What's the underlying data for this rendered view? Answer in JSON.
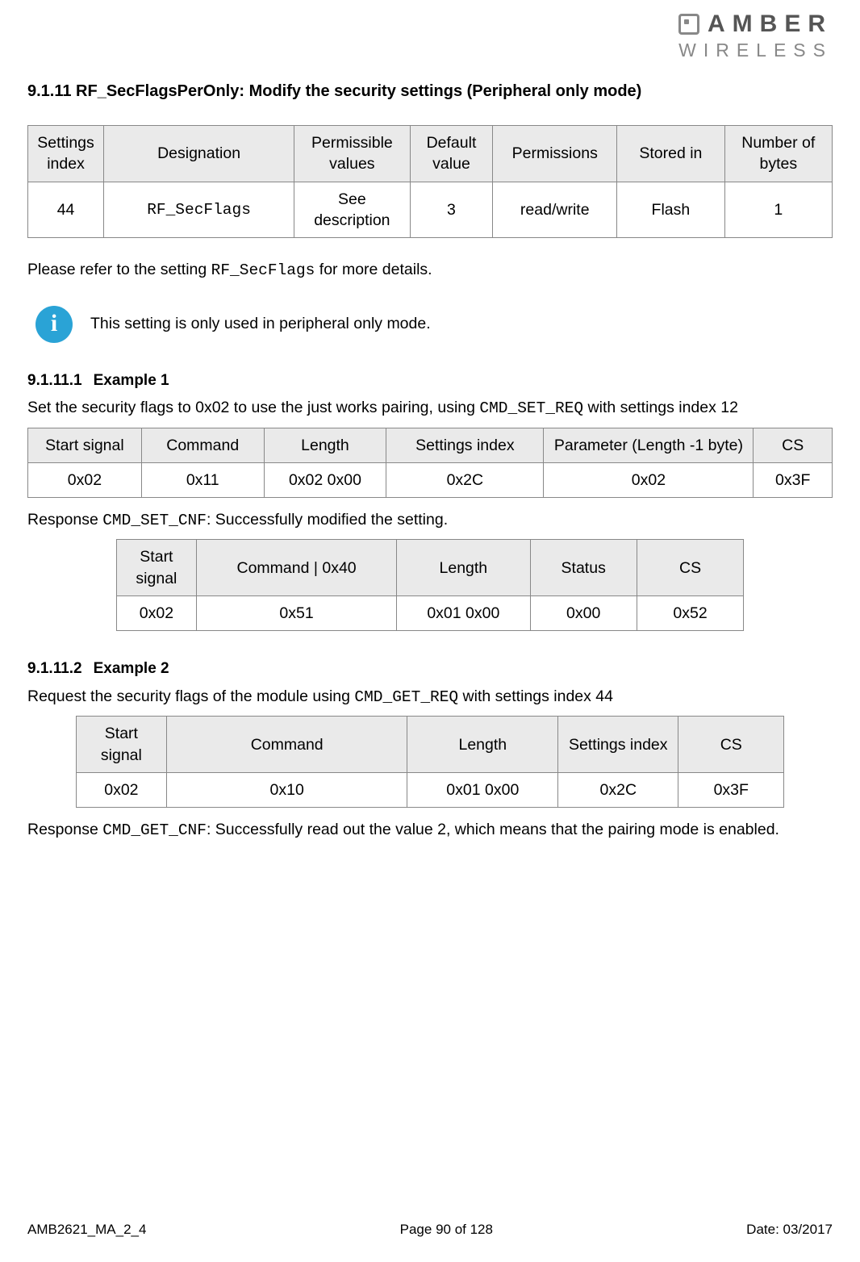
{
  "logo": {
    "line1": "AMBER",
    "line2": "WIRELESS"
  },
  "heading": "9.1.11 RF_SecFlagsPerOnly: Modify the security settings (Peripheral only mode)",
  "table_main": {
    "headers": [
      "Settings index",
      "Designation",
      "Permissible values",
      "Default value",
      "Permissions",
      "Stored in",
      "Number of bytes"
    ],
    "row": {
      "c0": "44",
      "c1": "RF_SecFlags",
      "c2": "See description",
      "c3": "3",
      "c4": "read/write",
      "c5": "Flash",
      "c6": "1"
    }
  },
  "para_refer_pre": "Please refer to the setting ",
  "para_refer_code": "RF_SecFlags",
  "para_refer_post": " for more details.",
  "info_text": "This setting is only used in peripheral only mode.",
  "ex1": {
    "num": "9.1.11.1",
    "title": "Example 1",
    "text_pre": "Set the security flags to 0x02 to use the just works pairing, using ",
    "text_code": "CMD_SET_REQ",
    "text_post": " with settings index 12",
    "req": {
      "headers": [
        "Start signal",
        "Command",
        "Length",
        "Settings index",
        "Parameter (Length -1 byte)",
        "CS"
      ],
      "row": {
        "c0": "0x02",
        "c1": "0x11",
        "c2": "0x02 0x00",
        "c3": "0x2C",
        "c4": "0x02",
        "c5": "0x3F"
      }
    },
    "resp_pre": "Response ",
    "resp_code": "CMD_SET_CNF",
    "resp_post": ": Successfully modified the setting.",
    "resp": {
      "headers": [
        "Start signal",
        "Command | 0x40",
        "Length",
        "Status",
        "CS"
      ],
      "row": {
        "c0": "0x02",
        "c1": "0x51",
        "c2": "0x01 0x00",
        "c3": "0x00",
        "c4": "0x52"
      }
    }
  },
  "ex2": {
    "num": "9.1.11.2",
    "title": "Example 2",
    "text_pre": "Request the security flags of the module using ",
    "text_code": "CMD_GET_REQ",
    "text_post": " with settings index 44",
    "req": {
      "headers": [
        "Start signal",
        "Command",
        "Length",
        "Settings index",
        "CS"
      ],
      "row": {
        "c0": "0x02",
        "c1": "0x10",
        "c2": "0x01 0x00",
        "c3": "0x2C",
        "c4": "0x3F"
      }
    },
    "resp_pre": "Response ",
    "resp_code": "CMD_GET_CNF",
    "resp_post": ": Successfully read out the value 2, which means that the pairing mode is enabled."
  },
  "footer": {
    "left": "AMB2621_MA_2_4",
    "center": "Page 90 of 128",
    "right": "Date: 03/2017"
  }
}
